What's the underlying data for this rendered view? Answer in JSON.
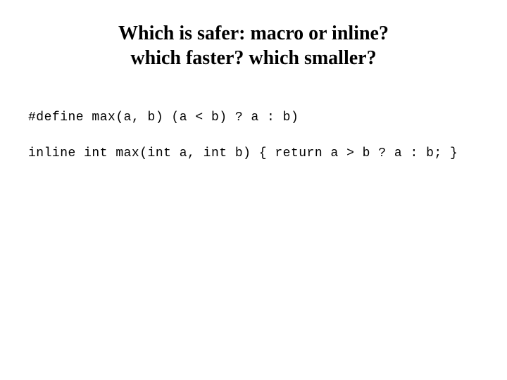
{
  "title": {
    "line1": "Which is safer: macro or inline?",
    "line2": "which faster? which smaller?"
  },
  "code": {
    "line1": "#define max(a, b) (a < b) ? a : b)",
    "line2": "inline int max(int a, int b) { return a > b ? a : b; }"
  }
}
